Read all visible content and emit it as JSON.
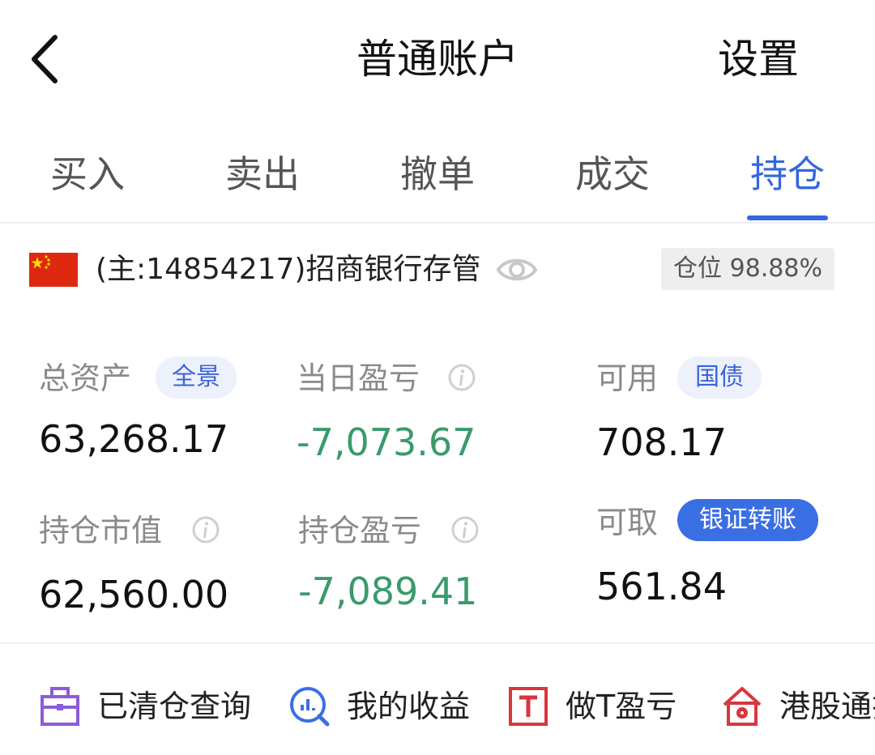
{
  "header": {
    "title": "普通账户",
    "settings_label": "设置"
  },
  "tabs": [
    {
      "label": "买入",
      "active": false
    },
    {
      "label": "卖出",
      "active": false
    },
    {
      "label": "撤单",
      "active": false
    },
    {
      "label": "成交",
      "active": false
    },
    {
      "label": "持仓",
      "active": true
    }
  ],
  "account": {
    "flag_icon": "china-flag-icon",
    "label": "(主:14854217)招商银行存管",
    "position_ratio": "仓位 98.88%"
  },
  "stats": {
    "total_assets": {
      "label": "总资产",
      "value": "63,268.17",
      "pill": "全景"
    },
    "daily_pl": {
      "label": "当日盈亏",
      "value": "-7,073.67"
    },
    "available": {
      "label": "可用",
      "value": "708.17",
      "pill": "国债"
    },
    "market_value": {
      "label": "持仓市值",
      "value": "62,560.00"
    },
    "position_pl": {
      "label": "持仓盈亏",
      "value": "-7,089.41"
    },
    "withdrawable": {
      "label": "可取",
      "value": "561.84",
      "pill": "银证转账"
    }
  },
  "shortcuts": [
    {
      "label": "已清仓查询",
      "icon": "briefcase-icon"
    },
    {
      "label": "我的收益",
      "icon": "chart-magnifier-icon"
    },
    {
      "label": "做T盈亏",
      "icon": "t-box-icon"
    },
    {
      "label": "港股通排",
      "icon": "hk-flower-house-icon"
    }
  ],
  "colors": {
    "accent": "#3467e0",
    "loss_green": "#3a9a6c",
    "label_gray": "#8a8a8a"
  }
}
